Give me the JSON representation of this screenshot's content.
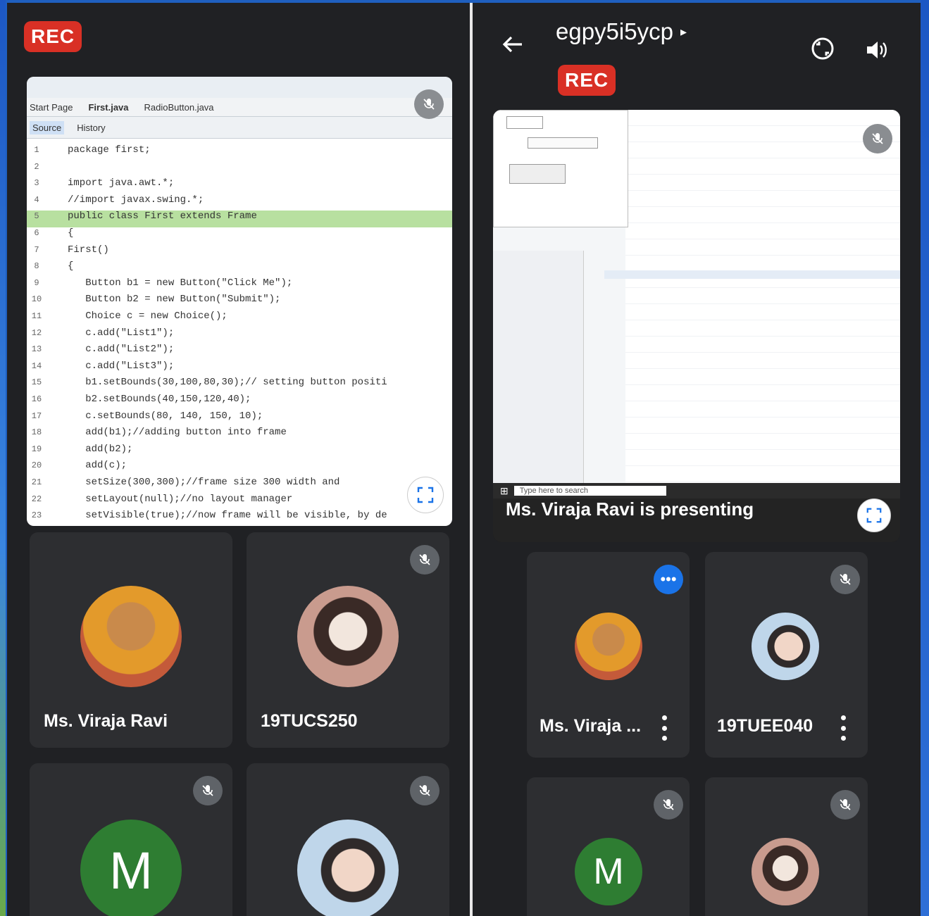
{
  "left": {
    "rec_label": "REC",
    "editor": {
      "tabs": [
        "Start Page",
        "First.java",
        "RadioButton.java"
      ],
      "subtabs": [
        "Source",
        "History"
      ],
      "lines": [
        {
          "n": "1",
          "code": "package first;"
        },
        {
          "n": "2",
          "code": ""
        },
        {
          "n": "3",
          "code": "import java.awt.*;"
        },
        {
          "n": "4",
          "code": "//import javax.swing.*;"
        },
        {
          "n": "5",
          "code": "public class First extends Frame"
        },
        {
          "n": "6",
          "code": "{"
        },
        {
          "n": "7",
          "code": "First()"
        },
        {
          "n": "8",
          "code": "{"
        },
        {
          "n": "9",
          "code": "   Button b1 = new Button(\"Click Me\");"
        },
        {
          "n": "10",
          "code": "   Button b2 = new Button(\"Submit\");"
        },
        {
          "n": "11",
          "code": "   Choice c = new Choice();"
        },
        {
          "n": "12",
          "code": "   c.add(\"List1\");"
        },
        {
          "n": "13",
          "code": "   c.add(\"List2\");"
        },
        {
          "n": "14",
          "code": "   c.add(\"List3\");"
        },
        {
          "n": "15",
          "code": "   b1.setBounds(30,100,80,30);// setting button positi"
        },
        {
          "n": "16",
          "code": "   b2.setBounds(40,150,120,40);"
        },
        {
          "n": "17",
          "code": "   c.setBounds(80, 140, 150, 10);"
        },
        {
          "n": "18",
          "code": "   add(b1);//adding button into frame"
        },
        {
          "n": "19",
          "code": "   add(b2);"
        },
        {
          "n": "20",
          "code": "   add(c);"
        },
        {
          "n": "21",
          "code": "   setSize(300,300);//frame size 300 width and"
        },
        {
          "n": "22",
          "code": "   setLayout(null);//no layout manager"
        },
        {
          "n": "23",
          "code": "   setVisible(true);//now frame will be visible, by de"
        }
      ]
    },
    "participants": [
      {
        "name": "Ms. Viraja Ravi"
      },
      {
        "name": "19TUCS250"
      },
      {
        "name": ""
      },
      {
        "name": ""
      }
    ],
    "initial_m": "M"
  },
  "right": {
    "meeting_code": "egpy5i5ycp",
    "rec_label": "REC",
    "presenting_text": "Ms. Viraja Ravi is presenting",
    "taskbar_search": "Type here to search",
    "participants": [
      {
        "name": "Ms. Viraja ..."
      },
      {
        "name": "19TUEE040"
      },
      {
        "name": ""
      },
      {
        "name": ""
      }
    ],
    "initial_m": "M"
  },
  "colors": {
    "background": "#202124",
    "tile": "#2d2e31",
    "rec": "#d93025",
    "avatar_m": "#2e7d32",
    "highlight_line": "#b8e0a0"
  }
}
